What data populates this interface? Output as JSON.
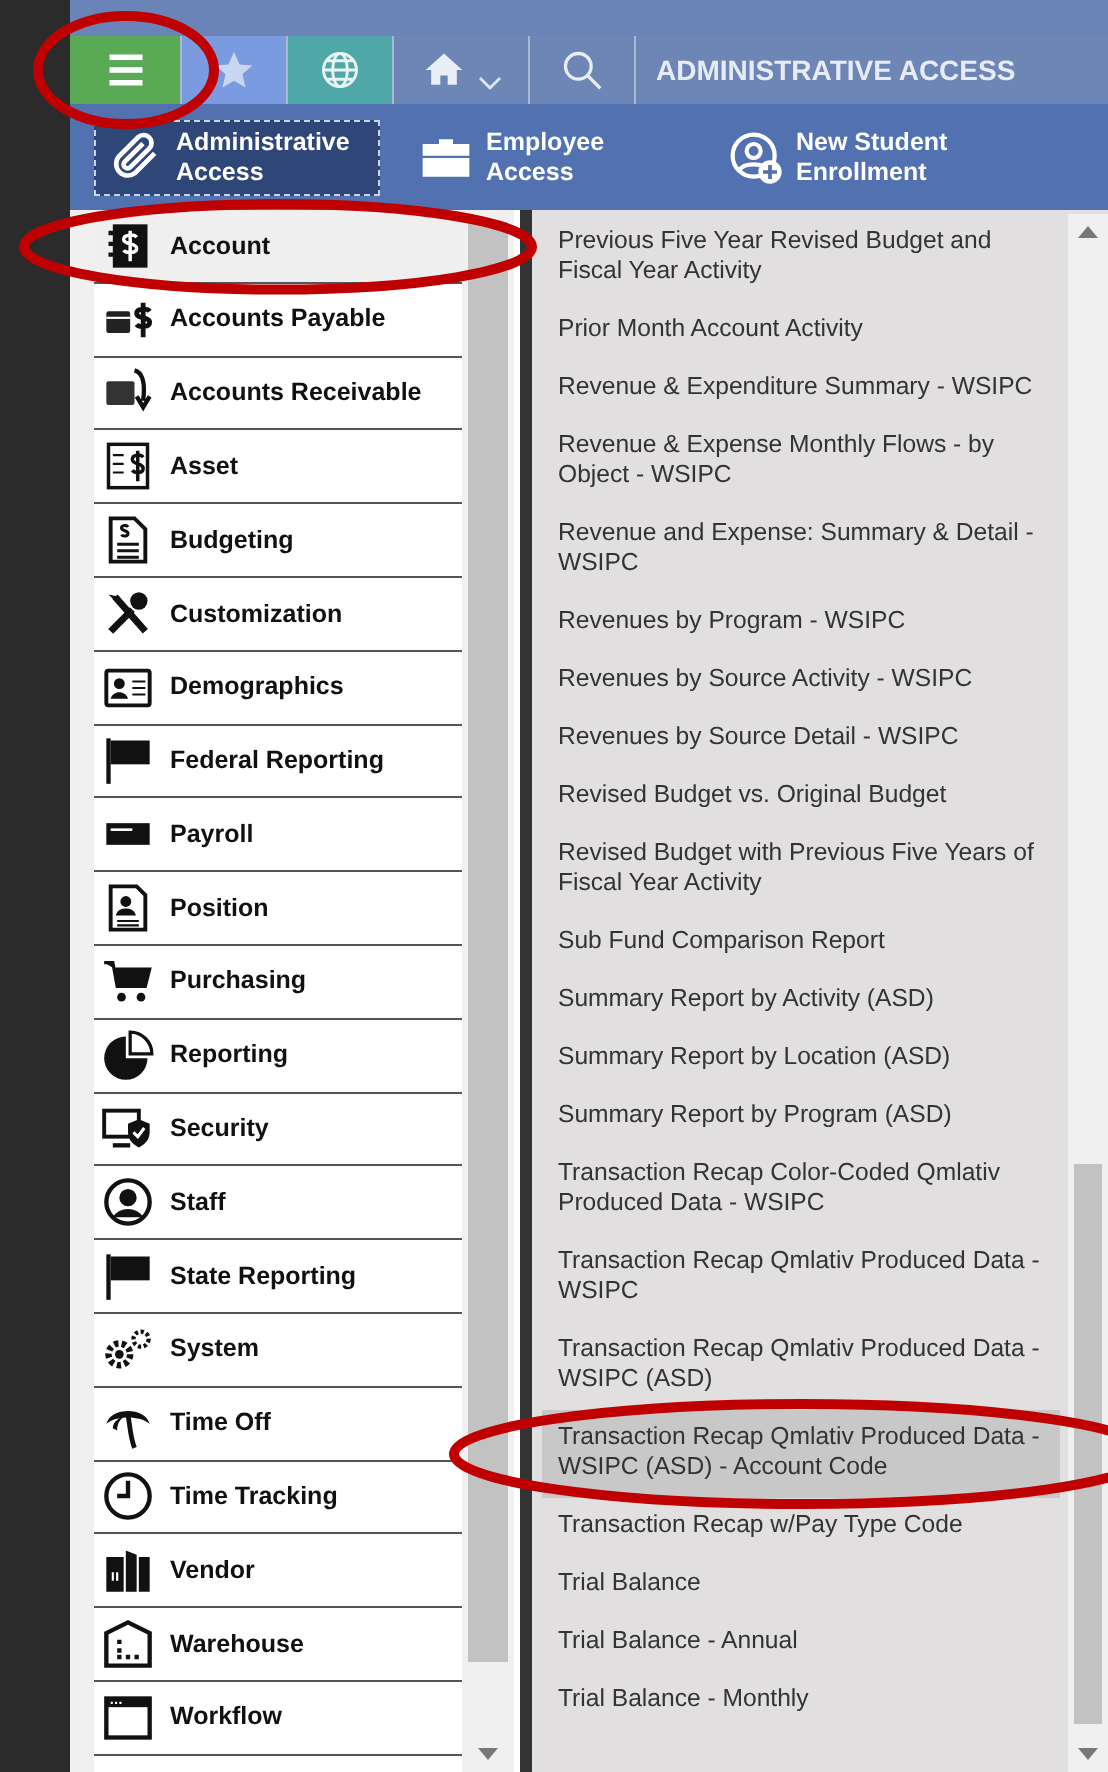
{
  "toolbar": {
    "buttons": [
      {
        "kind": "menu",
        "circled": true
      },
      {
        "kind": "favorites",
        "circled": false
      },
      {
        "kind": "globe",
        "circled": false
      },
      {
        "kind": "home",
        "circled": false
      },
      {
        "kind": "search",
        "circled": false
      }
    ],
    "title": "ADMINISTRATIVE ACCESS"
  },
  "access_buttons": [
    {
      "kind": "clip",
      "label": "Administrative Access",
      "selected": true
    },
    {
      "kind": "briefcase",
      "label": "Employee Access",
      "selected": false
    },
    {
      "kind": "student",
      "label": "New Student Enrollment",
      "selected": false
    }
  ],
  "modules": [
    {
      "label": "Account",
      "selected": true,
      "circled": true
    },
    {
      "label": "Accounts Payable",
      "selected": false,
      "circled": false
    },
    {
      "label": "Accounts Receivable",
      "selected": false,
      "circled": false
    },
    {
      "label": "Asset",
      "selected": false,
      "circled": false
    },
    {
      "label": "Budgeting",
      "selected": false,
      "circled": false
    },
    {
      "label": "Customization",
      "selected": false,
      "circled": false
    },
    {
      "label": "Demographics",
      "selected": false,
      "circled": false
    },
    {
      "label": "Federal Reporting",
      "selected": false,
      "circled": false
    },
    {
      "label": "Payroll",
      "selected": false,
      "circled": false
    },
    {
      "label": "Position",
      "selected": false,
      "circled": false
    },
    {
      "label": "Purchasing",
      "selected": false,
      "circled": false
    },
    {
      "label": "Reporting",
      "selected": false,
      "circled": false
    },
    {
      "label": "Security",
      "selected": false,
      "circled": false
    },
    {
      "label": "Staff",
      "selected": false,
      "circled": false
    },
    {
      "label": "State Reporting",
      "selected": false,
      "circled": false
    },
    {
      "label": "System",
      "selected": false,
      "circled": false
    },
    {
      "label": "Time Off",
      "selected": false,
      "circled": false
    },
    {
      "label": "Time Tracking",
      "selected": false,
      "circled": false
    },
    {
      "label": "Vendor",
      "selected": false,
      "circled": false
    },
    {
      "label": "Warehouse",
      "selected": false,
      "circled": false
    },
    {
      "label": "Workflow",
      "selected": false,
      "circled": false
    }
  ],
  "reports": [
    {
      "label": "Previous Five Year Revised Budget and Fiscal Year Activity",
      "selected": false,
      "circled": false
    },
    {
      "label": "Prior Month Account Activity",
      "selected": false,
      "circled": false
    },
    {
      "label": "Revenue & Expenditure Summary - WSIPC",
      "selected": false,
      "circled": false
    },
    {
      "label": "Revenue & Expense Monthly Flows - by Object - WSIPC",
      "selected": false,
      "circled": false
    },
    {
      "label": "Revenue and Expense: Summary & Detail - WSIPC",
      "selected": false,
      "circled": false
    },
    {
      "label": "Revenues by Program - WSIPC",
      "selected": false,
      "circled": false
    },
    {
      "label": "Revenues by Source Activity - WSIPC",
      "selected": false,
      "circled": false
    },
    {
      "label": "Revenues by Source Detail - WSIPC",
      "selected": false,
      "circled": false
    },
    {
      "label": "Revised Budget vs. Original Budget",
      "selected": false,
      "circled": false
    },
    {
      "label": "Revised Budget with Previous Five Years of Fiscal Year Activity",
      "selected": false,
      "circled": false
    },
    {
      "label": "Sub Fund Comparison Report",
      "selected": false,
      "circled": false
    },
    {
      "label": "Summary Report by Activity (ASD)",
      "selected": false,
      "circled": false
    },
    {
      "label": "Summary Report by Location (ASD)",
      "selected": false,
      "circled": false
    },
    {
      "label": "Summary Report by Program (ASD)",
      "selected": false,
      "circled": false
    },
    {
      "label": "Transaction Recap Color-Coded Qmlativ Produced Data - WSIPC",
      "selected": false,
      "circled": false
    },
    {
      "label": "Transaction Recap Qmlativ Produced Data - WSIPC",
      "selected": false,
      "circled": false
    },
    {
      "label": "Transaction Recap Qmlativ Produced Data - WSIPC (ASD)",
      "selected": false,
      "circled": false
    },
    {
      "label": "Transaction Recap Qmlativ Produced Data - WSIPC (ASD) - Account Code",
      "selected": true,
      "circled": true
    },
    {
      "label": "Transaction Recap w/Pay Type Code",
      "selected": false,
      "circled": false
    },
    {
      "label": "Trial Balance",
      "selected": false,
      "circled": false
    },
    {
      "label": "Trial Balance - Annual",
      "selected": false,
      "circled": false
    },
    {
      "label": "Trial Balance - Monthly",
      "selected": false,
      "circled": false
    }
  ]
}
